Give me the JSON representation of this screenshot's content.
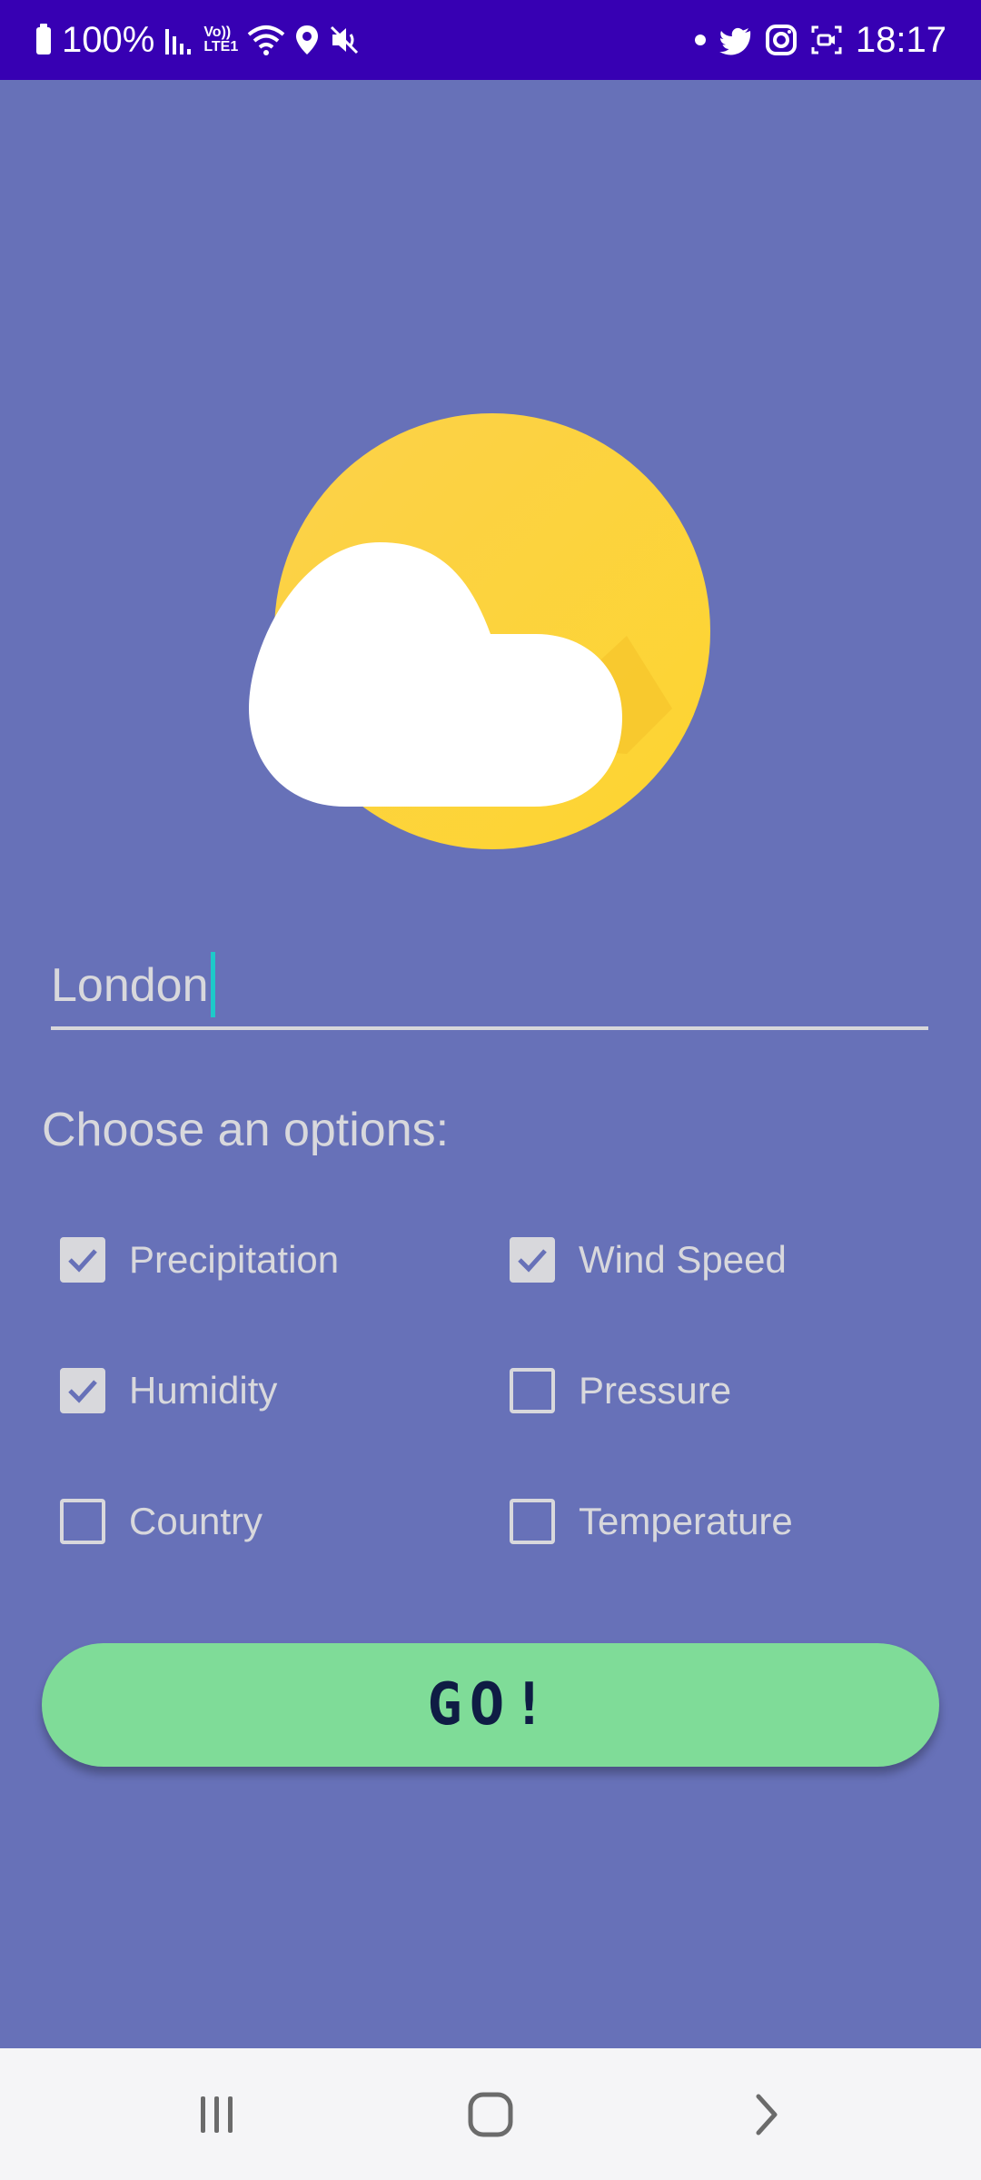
{
  "status_bar": {
    "battery_text": "100%",
    "volte_top": "Vo))",
    "volte_bottom": "LTE1",
    "time": "18:17",
    "icons": [
      "battery-icon",
      "signal-icon",
      "volte-icon",
      "wifi-icon",
      "location-icon",
      "mute-icon",
      "notification-dot-icon",
      "twitter-icon",
      "instagram-icon",
      "screen-record-icon"
    ]
  },
  "city_input": {
    "value": "London"
  },
  "options": {
    "heading": "Choose an options:",
    "items": [
      {
        "label": "Precipitation",
        "checked": true
      },
      {
        "label": "Wind Speed",
        "checked": true
      },
      {
        "label": "Humidity",
        "checked": true
      },
      {
        "label": "Pressure",
        "checked": false
      },
      {
        "label": "Country",
        "checked": false
      },
      {
        "label": "Temperature",
        "checked": false
      }
    ]
  },
  "go_button": {
    "label": "GO!"
  },
  "nav_bar": {
    "icons": [
      "recent-apps-icon",
      "home-icon",
      "back-icon"
    ]
  },
  "colors": {
    "status_bar": "#3700b3",
    "background": "#6771b8",
    "button": "#7fdc98",
    "nav_bar": "#f5f5f7"
  }
}
